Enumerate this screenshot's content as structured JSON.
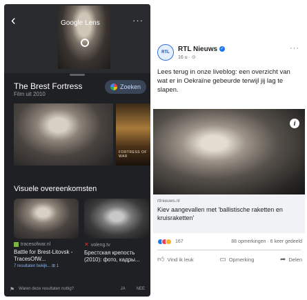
{
  "lens": {
    "brand": "Google Lens",
    "back_icon": "‹",
    "more_icon": "···",
    "title": "The Brest Fortress",
    "subtitle": "Film uit 2010",
    "search_button": "Zoeken",
    "poster_text": "FORTRESS OF WAR",
    "section_title": "Visuele overeenkomsten",
    "results": [
      {
        "source": "tracesofwar.nl",
        "title": "Battle for Brest-Litovsk - TracesOfW...",
        "meta": "7 resultaten bekijk... ⊞ 1"
      },
      {
        "source": "voleng.tv",
        "title": "Брестская крепость (2010): фото, кадры...",
        "meta": ""
      }
    ],
    "footer": {
      "question": "Waren deze resultaten nuttig?",
      "yes": "JA",
      "no": "NEE"
    }
  },
  "fb": {
    "avatar_text": "RTL",
    "page_name": "RTL Nieuws",
    "verified_mark": "✓",
    "meta": "16 u · ⊙",
    "more_icon": "···",
    "post_text": "Lees terug in onze liveblog: een overzicht van wat er in Oekraïne gebeurde terwijl jij lag te slapen.",
    "info_mark": "i",
    "link_domain": "rtlnieuws.nl",
    "link_title": "Kiev aangevallen met 'ballistische raketten en kruisraketten'",
    "reaction_count": "167",
    "comments_shares": "88 opmerkingen · 6 keer gedeeld",
    "actions": {
      "like": "Vind ik leuk",
      "comment": "Opmerking",
      "share": "Delen"
    }
  }
}
